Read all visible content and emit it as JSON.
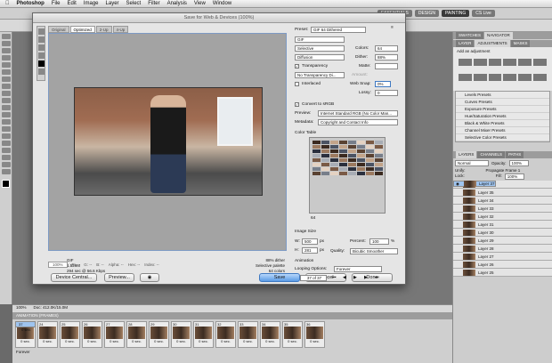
{
  "menubar": {
    "apple": "",
    "app_name": "Photoshop",
    "menus": [
      "File",
      "Edit",
      "Image",
      "Layer",
      "Select",
      "Filter",
      "Analysis",
      "View",
      "Window"
    ],
    "status": [
      "ESSENTIALS",
      "DESIGN",
      "PAINTING"
    ]
  },
  "workspace": {
    "essentials": "ESSENTIALS",
    "design": "DESIGN",
    "painting": "PAINTING",
    "cs_live": "CS Live"
  },
  "dialog": {
    "title": "Save for Web & Devices (100%)",
    "tabs": [
      "Original",
      "Optimized",
      "2-Up",
      "4-Up"
    ],
    "active_tab": "Optimized",
    "preview_info_left": [
      "GIF",
      "1.529M",
      "294 sec @ 56.6 Kbps"
    ],
    "preview_info_right": [
      "88% dither",
      "Selective palette",
      "64 colors"
    ],
    "zoom": "100%",
    "readouts": [
      "R: --",
      "G: --",
      "B: --",
      "Alpha: --",
      "Hex: --",
      "Index: --"
    ],
    "buttons": {
      "device_central": "Device Central...",
      "preview": "Preview...",
      "save": "Save",
      "cancel": "Cancel",
      "done": "Done"
    },
    "settings": {
      "preset_label": "Preset:",
      "preset_value": "GIF 64 Dithered",
      "format": "GIF",
      "reduction": "Selective",
      "dither_algo": "Diffusion",
      "colors_label": "Colors:",
      "colors": "64",
      "dither_label": "Dither:",
      "dither": "88%",
      "transparency_label": "Transparency",
      "matte_label": "Matte:",
      "transparency_dither": "No Transparency Di...",
      "amount_label": "Amount:",
      "interlaced_label": "Interlaced",
      "websnap_label": "Web Snap:",
      "websnap": "0%",
      "lossy_label": "Lossy:",
      "lossy": "0",
      "convert_label": "Convert to sRGB",
      "preview_label": "Preview:",
      "preview_value": "Internet Standard RGB (No Color Man...",
      "metadata_label": "Metadata:",
      "metadata_value": "Copyright and Contact Info",
      "color_table_label": "Color Table",
      "color_count": "64",
      "image_size_label": "Image Size",
      "width_label": "W:",
      "width": "500",
      "height_label": "H:",
      "height": "281",
      "px": "px",
      "percent_label": "Percent:",
      "percent": "100",
      "pct": "%",
      "quality_label": "Quality:",
      "quality": "Bicubic Smoother",
      "animation_label": "Animation",
      "looping_label": "Looping Options:",
      "looping": "Forever",
      "frame_counter": "37 of 37"
    }
  },
  "panels": {
    "top_tabs": [
      "SWATCHES",
      "NAVIGATOR"
    ],
    "adj_tabs": [
      "LAYER",
      "ADJUSTMENTS",
      "MASKS"
    ],
    "add_adjustment": "Add an adjustment",
    "presets": [
      "Levels Presets",
      "Curves Presets",
      "Exposure Presets",
      "Hue/Saturation Presets",
      "Black & White Presets",
      "Channel Mixer Presets",
      "Selective Color Presets"
    ],
    "layer_tabs": [
      "LAYERS",
      "CHANNELS",
      "PATHS"
    ],
    "blend_mode": "Normal",
    "opacity_label": "Opacity:",
    "opacity": "100%",
    "unify_label": "Unify:",
    "propagate_label": "Propagate Frame 1",
    "lock_label": "Lock:",
    "fill_label": "Fill:",
    "fill": "100%",
    "layers": [
      "Layer 37",
      "Layer 36",
      "Layer 35",
      "Layer 34",
      "Layer 33",
      "Layer 32",
      "Layer 31",
      "Layer 30",
      "Layer 29",
      "Layer 28",
      "Layer 27",
      "Layer 26",
      "Layer 25"
    ]
  },
  "status": {
    "zoom": "100%",
    "doc": "Doc: 412.0K/15.0M"
  },
  "animation": {
    "title": "ANIMATION (FRAMES)",
    "frames": [
      "23",
      "24",
      "25",
      "26",
      "27",
      "28",
      "29",
      "30",
      "31",
      "32",
      "33",
      "34",
      "35",
      "36",
      "37"
    ],
    "delay": "0 sec.",
    "loop": "Forever"
  },
  "colors": {
    "accent": "#3f79c2",
    "selection": "#9fc4ef"
  }
}
